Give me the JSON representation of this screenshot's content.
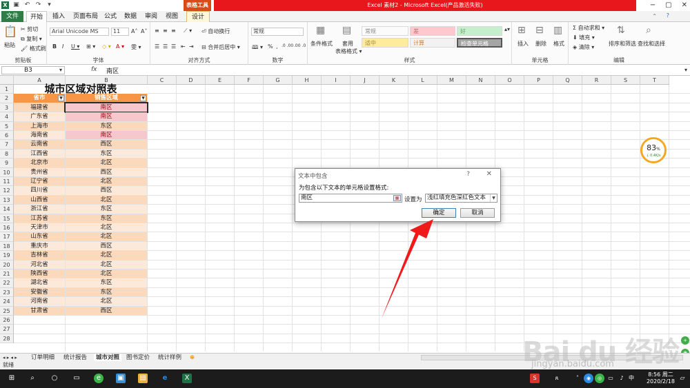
{
  "window": {
    "title": "Excel 素材2 - Microsoft Excel(产品激活失败)",
    "table_tools": "表格工具",
    "controls": [
      "−",
      "▢",
      "✕"
    ]
  },
  "ribbon_tabs": [
    "文件",
    "开始",
    "插入",
    "页面布局",
    "公式",
    "数据",
    "审阅",
    "视图",
    "设计"
  ],
  "ribbon": {
    "clipboard": {
      "paste": "粘贴",
      "cut": "剪切",
      "copy": "复制 ▾",
      "format_painter": "格式刷",
      "label": "剪贴板"
    },
    "font": {
      "name": "Arial Unicode MS",
      "size": "11",
      "grow": "A˄",
      "shrink": "A˅",
      "bold": "B",
      "italic": "I",
      "underline": "U ▾",
      "border": "⊞ ▾",
      "fill": "◇ ▾",
      "color": "A ▾",
      "phonetic": "雯 ▾",
      "label": "字体"
    },
    "alignment": {
      "wrap": "自动换行",
      "merge": "合并后居中 ▾",
      "label": "对齐方式"
    },
    "number": {
      "format": "常规",
      "currency": "🕮 ▾",
      "percent": "%",
      "comma": ",",
      "dec_inc": ".0 .00",
      "dec_dec": ".00 .0",
      "label": "数字"
    },
    "styles": {
      "conditional": "条件格式",
      "as_table": "套用",
      "as_table2": "表格格式 ▾",
      "cells": [
        "常规",
        "差",
        "好",
        "适中",
        "计算",
        "检查单元格"
      ],
      "label": "样式"
    },
    "cells": {
      "insert": "插入",
      "delete": "删除",
      "format": "格式",
      "label": "单元格"
    },
    "editing": {
      "autosum": "Σ 自动求和 ▾",
      "fill": "填充 ▾",
      "clear": "清除 ▾",
      "sort": "排序和筛选",
      "find": "查找和选择",
      "label": "编辑"
    }
  },
  "formula_bar": {
    "name_box": "B3",
    "fx": "fx",
    "value": "南区"
  },
  "columns": [
    "A",
    "B",
    "C",
    "D",
    "E",
    "F",
    "G",
    "H",
    "I",
    "J",
    "K",
    "L",
    "M",
    "N",
    "O",
    "P",
    "Q",
    "R",
    "S",
    "T"
  ],
  "sheet": {
    "title": "城市区域对照表",
    "headers": [
      "省市",
      "销售区域"
    ],
    "rows": [
      [
        "福建省",
        "南区"
      ],
      [
        "广东省",
        "南区"
      ],
      [
        "上海市",
        "东区"
      ],
      [
        "海南省",
        "南区"
      ],
      [
        "云南省",
        "西区"
      ],
      [
        "江西省",
        "东区"
      ],
      [
        "北京市",
        "北区"
      ],
      [
        "贵州省",
        "西区"
      ],
      [
        "辽宁省",
        "北区"
      ],
      [
        "四川省",
        "西区"
      ],
      [
        "山西省",
        "北区"
      ],
      [
        "浙江省",
        "东区"
      ],
      [
        "江苏省",
        "东区"
      ],
      [
        "天津市",
        "北区"
      ],
      [
        "山东省",
        "北区"
      ],
      [
        "重庆市",
        "西区"
      ],
      [
        "吉林省",
        "北区"
      ],
      [
        "河北省",
        "北区"
      ],
      [
        "陕西省",
        "北区"
      ],
      [
        "湖北省",
        "东区"
      ],
      [
        "安徽省",
        "东区"
      ],
      [
        "河南省",
        "北区"
      ],
      [
        "甘肃省",
        "西区"
      ]
    ],
    "row_numbers": [
      "1",
      "2",
      "3",
      "4",
      "5",
      "6",
      "7",
      "8",
      "9",
      "10",
      "11",
      "12",
      "13",
      "14",
      "15",
      "16",
      "17",
      "18",
      "19",
      "20",
      "21",
      "22",
      "23",
      "24",
      "25",
      "26",
      "27",
      "28"
    ]
  },
  "sheet_tabs": [
    "订单明细",
    "统计报告",
    "城市对照",
    "图书定价",
    "统计样例"
  ],
  "sheet_nav": "◂ ▸ ◂ ▸",
  "status": "就绪",
  "dialog": {
    "title": "文本中包含",
    "help": "?",
    "close": "✕",
    "prompt": "为包含以下文本的单元格设置格式:",
    "value": "南区",
    "set_as": "设置为",
    "format": "浅红填充色深红色文本",
    "ok": "确定",
    "cancel": "取消"
  },
  "speed_widget": {
    "value": "83",
    "unit": "%",
    "speed": "↓ 0.4K/s"
  },
  "taskbar": {
    "time": "8:56 周二",
    "date": "2020/2/18"
  },
  "watermark": {
    "text": "Bai du 经验",
    "url": "jingyan.baidu.com"
  },
  "colors": {
    "header": "#f79646",
    "band_odd": "#fbd9bd",
    "band_even": "#fde9d9",
    "highlight": "#f7c7ce",
    "highlight_text": "#9c0006",
    "excel_green": "#1e7145",
    "title_red": "#e8171c"
  }
}
